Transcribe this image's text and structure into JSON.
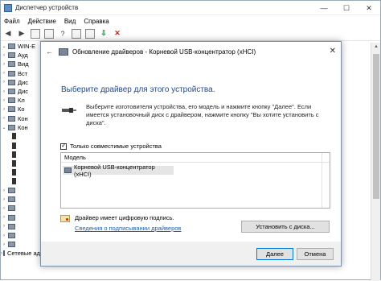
{
  "devmgr": {
    "title": "Диспетчер устройств",
    "window_controls": {
      "min": "—",
      "max": "☐",
      "close": "✕"
    },
    "menu": [
      "Файл",
      "Действие",
      "Вид",
      "Справка"
    ],
    "tree": [
      {
        "label": "WIN-E",
        "chev": "⌄"
      },
      {
        "label": "Ауд",
        "chev": "›"
      },
      {
        "label": "Вид",
        "chev": "›"
      },
      {
        "label": "Вст",
        "chev": "›"
      },
      {
        "label": "Дис",
        "chev": "›"
      },
      {
        "label": "Дис",
        "chev": "›"
      },
      {
        "label": "Кл",
        "chev": "›"
      },
      {
        "label": "Ко",
        "chev": "›"
      },
      {
        "label": "Кон",
        "chev": "›"
      },
      {
        "label": "Кон",
        "chev": "⌄"
      }
    ],
    "bottom_item": "Сетевые адаптеры"
  },
  "dialog": {
    "header_title": "Обновление драйверов - Корневой USB-концентратор (xHCI)",
    "close": "✕",
    "back": "←",
    "heading": "Выберите драйвер для этого устройства.",
    "description": "Выберите изготовителя устройства, его модель и нажмите кнопку \"Далее\". Если имеется установочный диск с драйвером, нажмите кнопку \"Вы хотите установить с диска\".",
    "compat_label": "Только совместимые устройства",
    "list_header": "Модель",
    "list_item": "Корневой USB-концентратор (xHCI)",
    "signed_text": "Драйвер имеет цифровую подпись.",
    "signing_link": "Сведения о подписывании драйверов",
    "install_disk_btn": "Установить с диска...",
    "next_btn": "Далее",
    "cancel_btn": "Отмена"
  }
}
